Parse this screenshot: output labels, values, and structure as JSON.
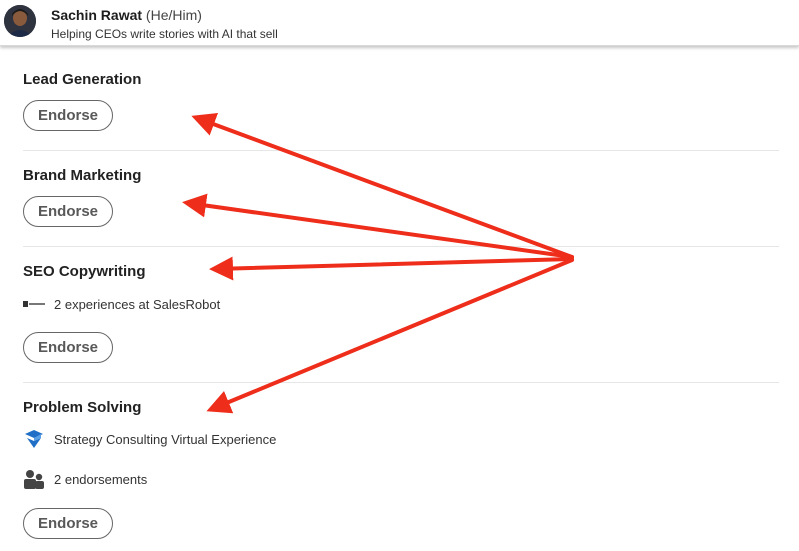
{
  "profile": {
    "name": "Sachin Rawat",
    "pronouns": "(He/Him)",
    "headline": "Helping CEOs write stories with AI that sell"
  },
  "endorse_label": "Endorse",
  "skills": [
    {
      "name": "Lead Generation"
    },
    {
      "name": "Brand Marketing"
    },
    {
      "name": "SEO Copywriting",
      "experience": "2 experiences at SalesRobot",
      "experience_icon": "salesrobot-logo-icon"
    },
    {
      "name": "Problem Solving",
      "experience": "Strategy Consulting Virtual Experience",
      "experience_icon": "strategy-consulting-logo-icon",
      "endorsements": "2 endorsements",
      "endorsements_icon": "people-icon"
    }
  ],
  "annotation": {
    "arrow_color": "#ee2d1b",
    "arrow_count": 4
  },
  "colors": {
    "divider": "#e6e6e6",
    "button_border": "#666666",
    "logo_blue": "#1f6fc6"
  }
}
